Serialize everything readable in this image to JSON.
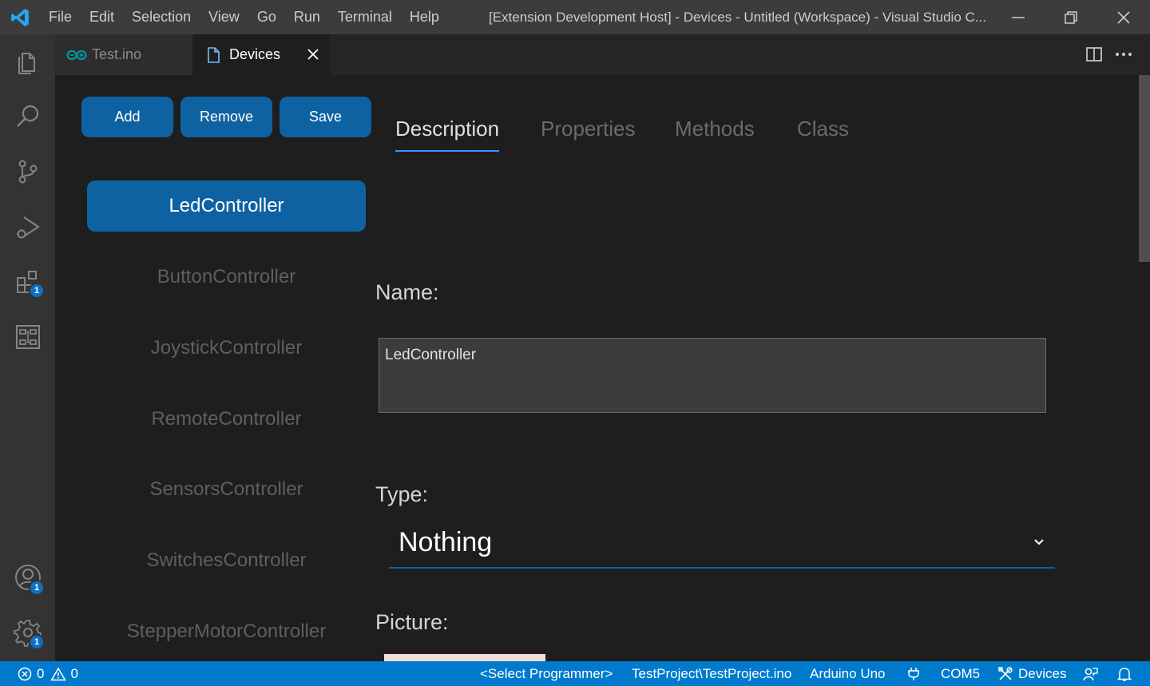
{
  "titlebar": {
    "menu": [
      "File",
      "Edit",
      "Selection",
      "View",
      "Go",
      "Run",
      "Terminal",
      "Help"
    ],
    "window_title": "[Extension Development Host] - Devices - Untitled (Workspace) - Visual Studio C..."
  },
  "activity": {
    "extensions_badge": "1",
    "accounts_badge": "1",
    "settings_badge": "1"
  },
  "tabs": [
    {
      "label": "Test.ino",
      "icon": "arduino-icon"
    },
    {
      "label": "Devices",
      "icon": "file-icon"
    }
  ],
  "toolbar": {
    "add_label": "Add",
    "remove_label": "Remove",
    "save_label": "Save"
  },
  "detail_tabs": [
    "Description",
    "Properties",
    "Methods",
    "Class"
  ],
  "devices": {
    "selected": "LedController",
    "items": [
      "ButtonController",
      "JoystickController",
      "RemoteController",
      "SensorsController",
      "SwitchesController",
      "StepperMotorController"
    ]
  },
  "form": {
    "name_label": "Name:",
    "name_value": "LedController",
    "type_label": "Type:",
    "type_value": "Nothing",
    "picture_label": "Picture:"
  },
  "statusbar": {
    "errors": "0",
    "warnings": "0",
    "programmer": "<Select Programmer>",
    "sketch": "TestProject\\TestProject.ino",
    "board": "Arduino Uno",
    "port": "COM5",
    "devices": "Devices"
  },
  "colors": {
    "accent": "#0f62a1",
    "statusbar": "#007acc",
    "activitybar": "#333333",
    "editor_bg": "#1e1e1e"
  }
}
